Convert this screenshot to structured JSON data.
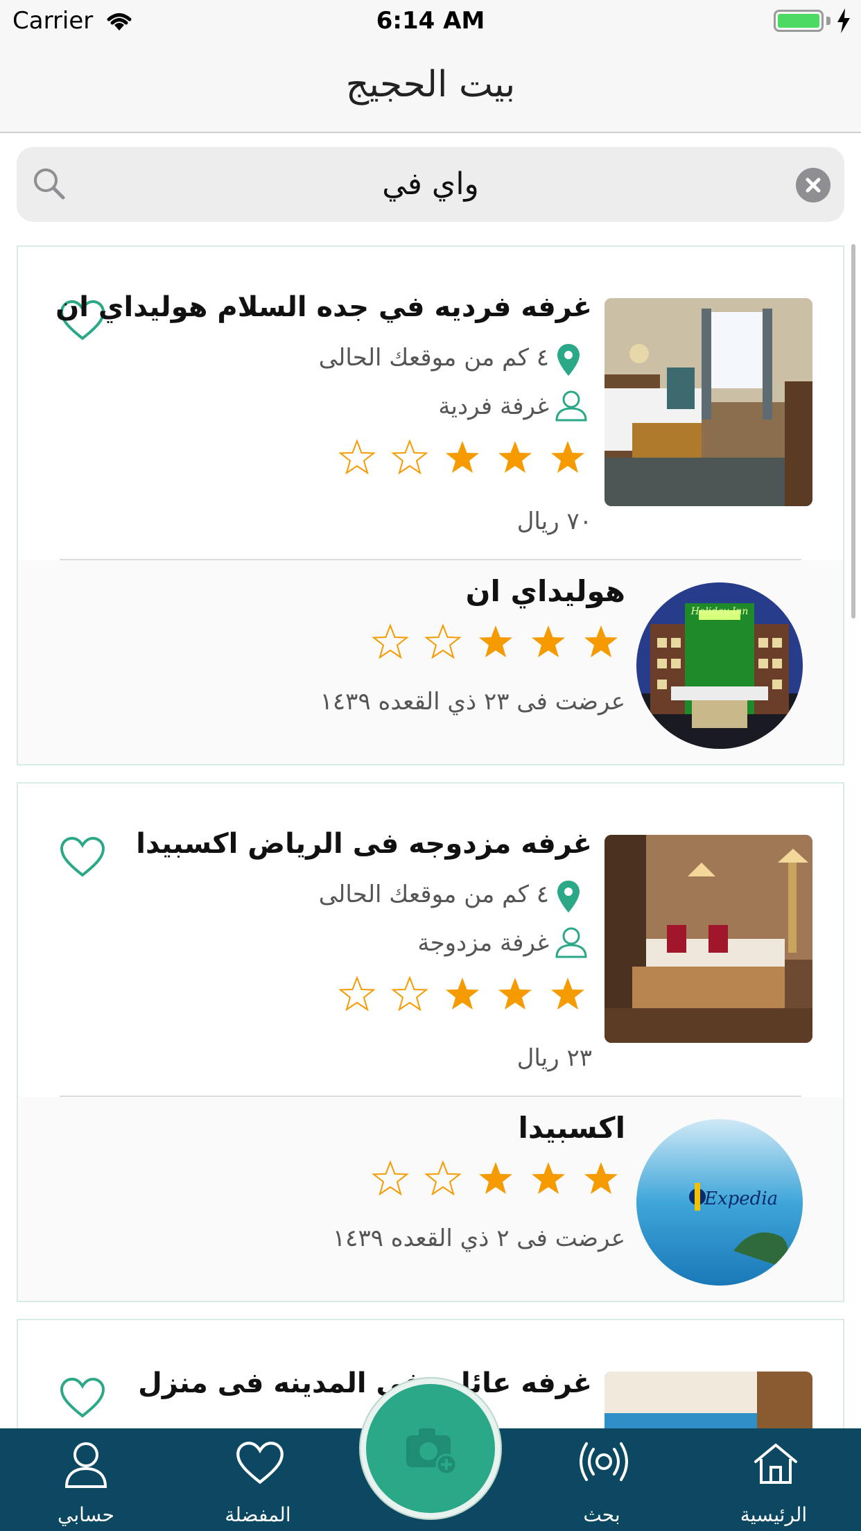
{
  "status_bar": {
    "carrier": "Carrier",
    "time": "6:14 AM",
    "icons": [
      "wifi-icon",
      "battery-icon",
      "charging-bolt-icon"
    ]
  },
  "nav": {
    "title": "بيت الحجيج"
  },
  "search": {
    "value": "واي في",
    "icons": [
      "search-icon",
      "clear-icon"
    ]
  },
  "listings": [
    {
      "title": "غرفه  فرديه في جده السلام هوليداي ان",
      "distance": "٤ كم من موقعك الحالى",
      "room_type": "غرفة فردية",
      "rating": 3,
      "max_rating": 5,
      "price": "٧٠ ريال",
      "hotel": {
        "name": "هوليداي ان",
        "rating": 3,
        "offered": "عرضت فى ٢٣ ذي القعده ١٤٣٩"
      }
    },
    {
      "title": "غرفه مزدوجه فى الرياض  اكسبيدا",
      "distance": "٤ كم من موقعك الحالى",
      "room_type": "غرفة مزدوجة",
      "rating": 3,
      "max_rating": 5,
      "price": "٢٣ ريال",
      "hotel": {
        "name": "اكسبيدا",
        "logo_text": "Expedia",
        "rating": 3,
        "offered": "عرضت فى ٢ ذي القعده ١٤٣٩"
      }
    },
    {
      "title": "غرفه عائلية في المدينه فى منزل"
    }
  ],
  "hotel_logo_text": {
    "holiday_inn": "Holiday Inn"
  },
  "tabs": [
    {
      "label": "حسابي",
      "icon": "person-icon"
    },
    {
      "label": "المفضلة",
      "icon": "heart-icon"
    },
    {
      "label": "بحث",
      "icon": "broadcast-icon"
    },
    {
      "label": "الرئيسية",
      "icon": "home-icon"
    }
  ],
  "fab": {
    "icon": "camera-add-icon"
  },
  "colors": {
    "accent_green": "#2aa887",
    "star_orange": "#f59b00",
    "tab_bar": "#0d4863"
  }
}
